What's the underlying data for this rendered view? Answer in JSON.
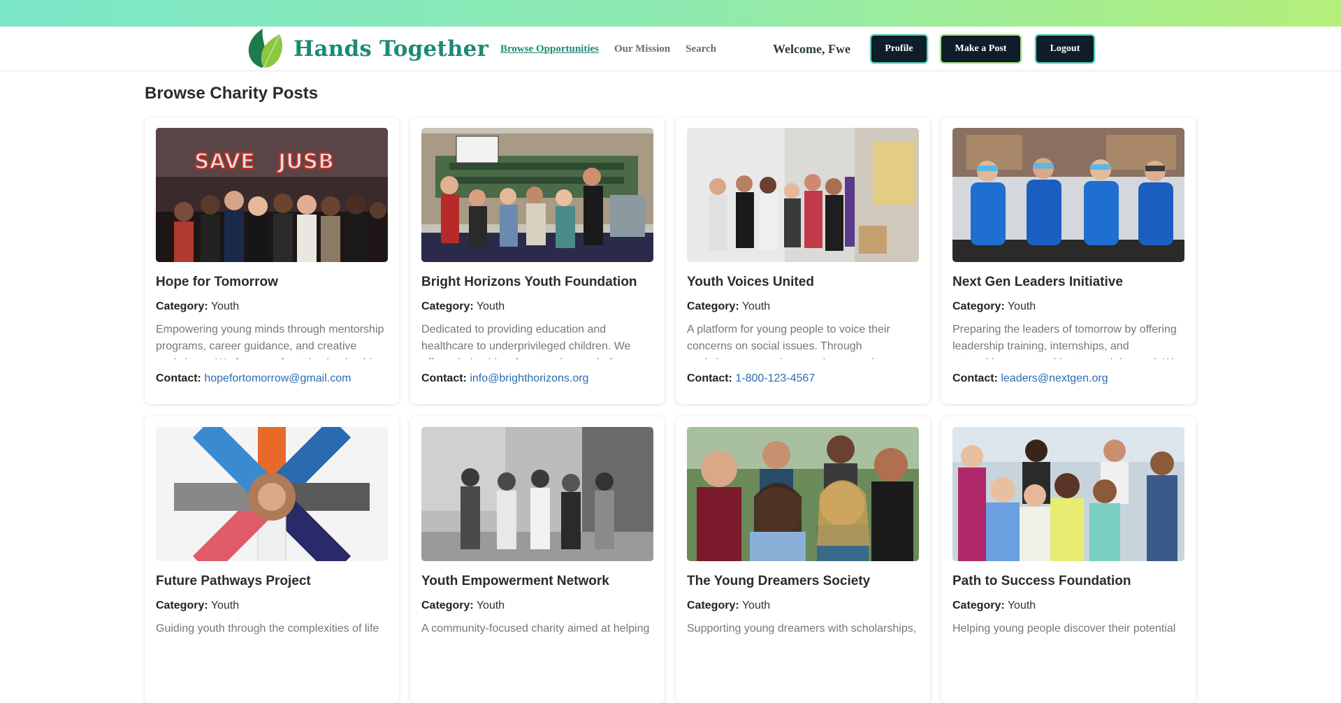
{
  "brand": {
    "name": "Hands Together",
    "logo_icon": "leaf-logo-icon"
  },
  "nav": {
    "links": [
      {
        "label": "Browse Opportunities",
        "active": true
      },
      {
        "label": "Our Mission",
        "active": false
      },
      {
        "label": "Search",
        "active": false
      }
    ],
    "welcome": "Welcome, Fwe",
    "buttons": {
      "profile": "Profile",
      "post": "Make a Post",
      "logout": "Logout"
    }
  },
  "page": {
    "title": "Browse Charity Posts"
  },
  "labels": {
    "category": "Category:",
    "contact": "Contact:"
  },
  "posts": [
    {
      "title": "Hope for Tomorrow",
      "category": "Youth",
      "description": "Empowering young minds through mentorship programs, career guidance, and creative workshops. We focus on fostering leadership",
      "contact": "hopefortomorrow@gmail.com",
      "image": "group-photo-save-jusb-banner"
    },
    {
      "title": "Bright Horizons Youth Foundation",
      "category": "Youth",
      "description": "Dedicated to providing education and healthcare to underprivileged children. We offer scholarships, free tutoring, and after-",
      "contact": "info@brighthorizons.org",
      "image": "group-photo-parliament-backdrop"
    },
    {
      "title": "Youth Voices United",
      "category": "Youth",
      "description": "A platform for young people to voice their concerns on social issues. Through workshops, campaigns, and community",
      "contact": "1-800-123-4567",
      "image": "group-photo-community-room"
    },
    {
      "title": "Next Gen Leaders Initiative",
      "category": "Youth",
      "description": "Preparing the leaders of tomorrow by offering leadership training, internships, and networking opportunities to youth in need. We",
      "contact": "leaders@nextgen.org",
      "image": "group-photo-ski-resort"
    },
    {
      "title": "Future Pathways Project",
      "category": "Youth",
      "description": "Guiding youth through the complexities of life",
      "contact": "",
      "image": "hands-stacked-circle"
    },
    {
      "title": "Youth Empowerment Network",
      "category": "Youth",
      "description": "A community-focused charity aimed at helping",
      "contact": "",
      "image": "group-walking-black-and-white"
    },
    {
      "title": "The Young Dreamers Society",
      "category": "Youth",
      "description": "Supporting young dreamers with scholarships,",
      "contact": "",
      "image": "smiling-teens-group"
    },
    {
      "title": "Path to Success Foundation",
      "category": "Youth",
      "description": "Helping young people discover their potential",
      "contact": "",
      "image": "diverse-students-group"
    }
  ],
  "colors": {
    "brand": "#1d8a73",
    "button_bg": "#0f1c2a",
    "link": "#2b6cb0",
    "gradient_start": "#7ae6c8",
    "gradient_end": "#b4ef7a"
  }
}
